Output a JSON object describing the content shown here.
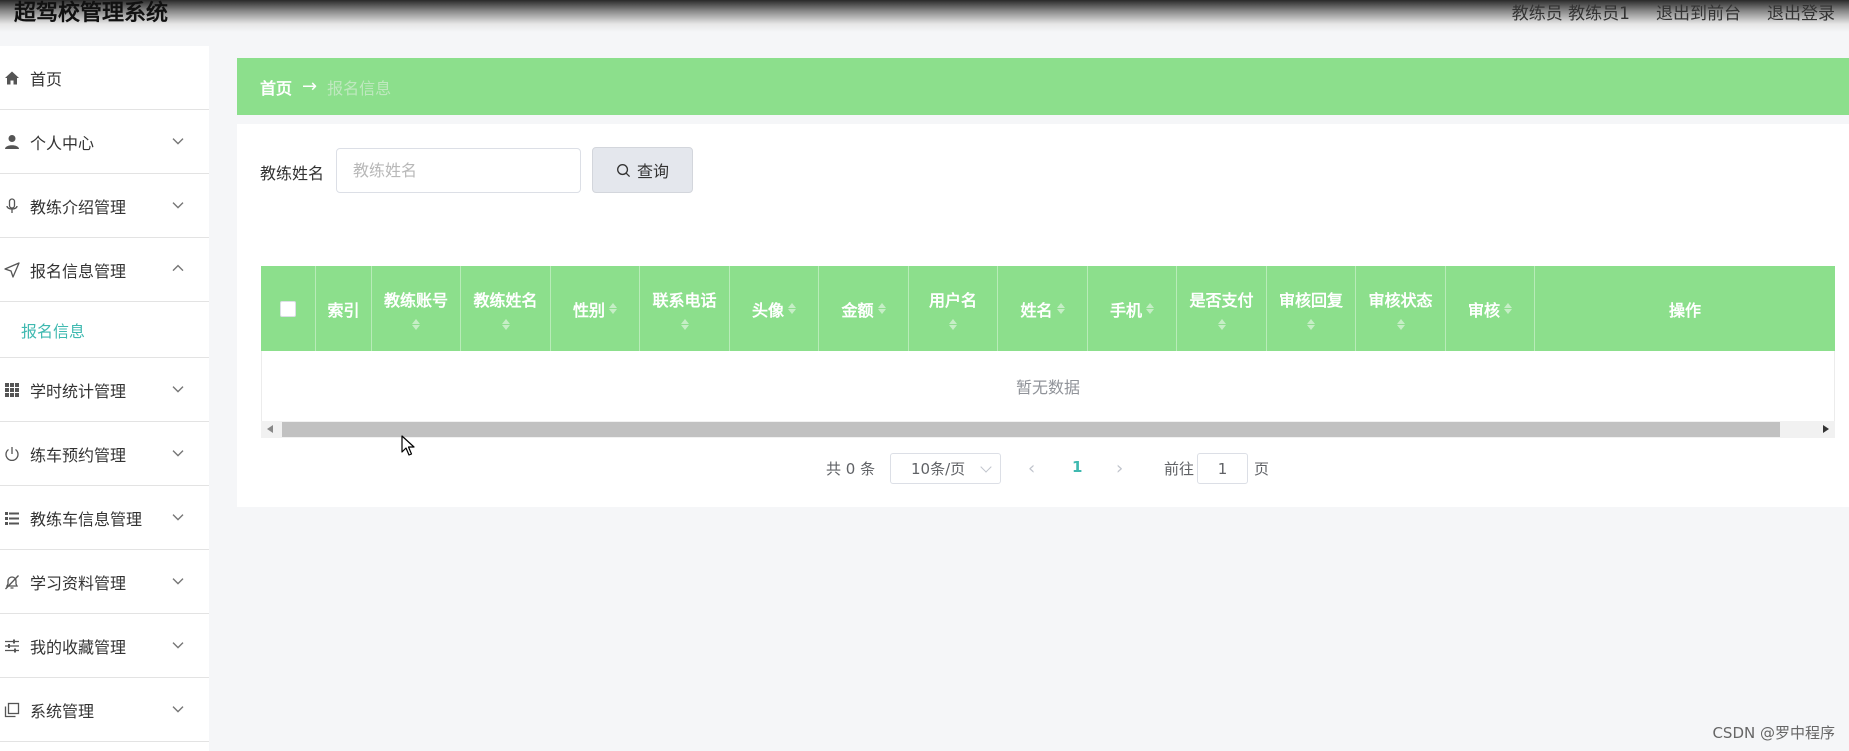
{
  "header": {
    "title": "超驾校管理系统",
    "user": "教练员 教练员1",
    "to_front": "退出到前台",
    "logout": "退出登录"
  },
  "sidebar": {
    "items": [
      {
        "label": "首页",
        "icon": "home-icon",
        "expandable": false
      },
      {
        "label": "个人中心",
        "icon": "user-icon",
        "expandable": true
      },
      {
        "label": "教练介绍管理",
        "icon": "microphone-icon",
        "expandable": true
      },
      {
        "label": "报名信息管理",
        "icon": "send-icon",
        "expandable": true,
        "expanded": true,
        "children": [
          "报名信息"
        ]
      },
      {
        "label": "学时统计管理",
        "icon": "grid-icon",
        "expandable": true
      },
      {
        "label": "练车预约管理",
        "icon": "power-icon",
        "expandable": true
      },
      {
        "label": "教练车信息管理",
        "icon": "list-icon",
        "expandable": true
      },
      {
        "label": "学习资料管理",
        "icon": "bell-off-icon",
        "expandable": true
      },
      {
        "label": "我的收藏管理",
        "icon": "sliders-icon",
        "expandable": true
      },
      {
        "label": "系统管理",
        "icon": "copy-icon",
        "expandable": true
      }
    ]
  },
  "breadcrumb": {
    "home": "首页",
    "separator": "→",
    "current": "报名信息"
  },
  "search": {
    "label": "教练姓名",
    "placeholder": "教练姓名",
    "value": "",
    "button": "查询"
  },
  "table": {
    "columns": [
      "索引",
      "教练账号",
      "教练姓名",
      "性别",
      "联系电话",
      "头像",
      "金额",
      "用户名",
      "姓名",
      "手机",
      "是否支付",
      "审核回复",
      "审核状态",
      "审核",
      "操作"
    ],
    "empty_text": "暂无数据"
  },
  "pagination": {
    "total": "共 0 条",
    "page_size": "10条/页",
    "current_page": "1",
    "goto_label": "前往",
    "goto_value": "1",
    "page_suffix": "页"
  },
  "watermark": "CSDN @罗中程序",
  "colors": {
    "accent_green": "#8cdf8c",
    "active_teal": "#3fb9b0"
  }
}
